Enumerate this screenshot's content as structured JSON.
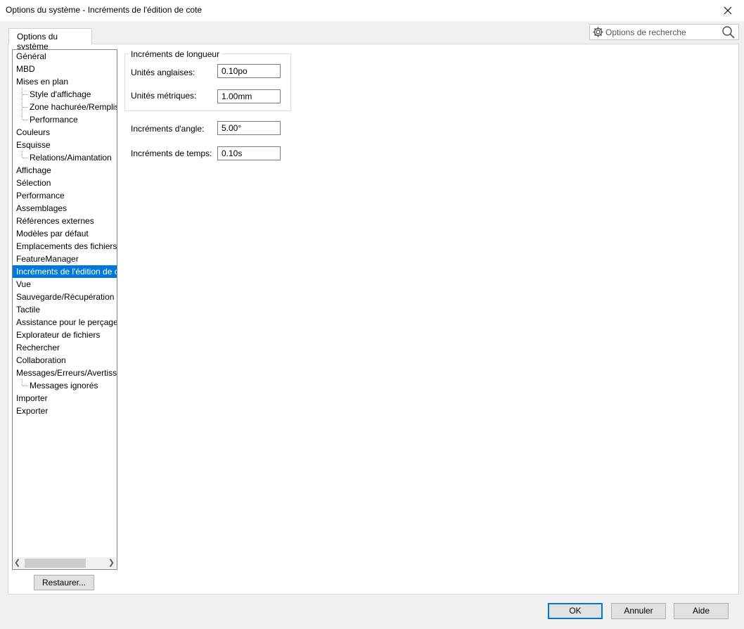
{
  "window": {
    "title": "Options du système - Incréments de l'édition de cote"
  },
  "tab": {
    "label": "Options du système"
  },
  "search": {
    "placeholder": "Options de recherche"
  },
  "tree": {
    "items": [
      {
        "label": "Général",
        "child": false
      },
      {
        "label": "MBD",
        "child": false
      },
      {
        "label": "Mises en plan",
        "child": false
      },
      {
        "label": "Style d'affichage",
        "child": true
      },
      {
        "label": "Zone hachurée/Remplissage",
        "child": true
      },
      {
        "label": "Performance",
        "child": true
      },
      {
        "label": "Couleurs",
        "child": false
      },
      {
        "label": "Esquisse",
        "child": false
      },
      {
        "label": "Relations/Aimantation",
        "child": true
      },
      {
        "label": "Affichage",
        "child": false
      },
      {
        "label": "Sélection",
        "child": false
      },
      {
        "label": "Performance",
        "child": false
      },
      {
        "label": "Assemblages",
        "child": false
      },
      {
        "label": "Références externes",
        "child": false
      },
      {
        "label": "Modèles par défaut",
        "child": false
      },
      {
        "label": "Emplacements des fichiers",
        "child": false
      },
      {
        "label": "FeatureManager",
        "child": false
      },
      {
        "label": "Incréments de l'édition de cote",
        "child": false,
        "selected": true
      },
      {
        "label": "Vue",
        "child": false
      },
      {
        "label": "Sauvegarde/Récupération",
        "child": false
      },
      {
        "label": "Tactile",
        "child": false
      },
      {
        "label": "Assistance pour le perçage/",
        "child": false
      },
      {
        "label": "Explorateur de fichiers",
        "child": false
      },
      {
        "label": "Rechercher",
        "child": false
      },
      {
        "label": "Collaboration",
        "child": false
      },
      {
        "label": "Messages/Erreurs/Avertissements",
        "child": false
      },
      {
        "label": "Messages ignorés",
        "child": true
      },
      {
        "label": "Importer",
        "child": false
      },
      {
        "label": "Exporter",
        "child": false
      }
    ]
  },
  "restore_label": "Restaurer...",
  "length_group": {
    "title": "Incréments de longueur",
    "english_label": "Unités anglaises:",
    "english_value": "0.10po",
    "metric_label": "Unités métriques:",
    "metric_value": "1.00mm"
  },
  "angle": {
    "label": "Incréments d'angle:",
    "value": "5.00°"
  },
  "time": {
    "label": "Incréments de temps:",
    "value": "0.10s"
  },
  "buttons": {
    "ok": "OK",
    "cancel": "Annuler",
    "help": "Aide"
  },
  "colors": {
    "selection": "#0078d7"
  }
}
